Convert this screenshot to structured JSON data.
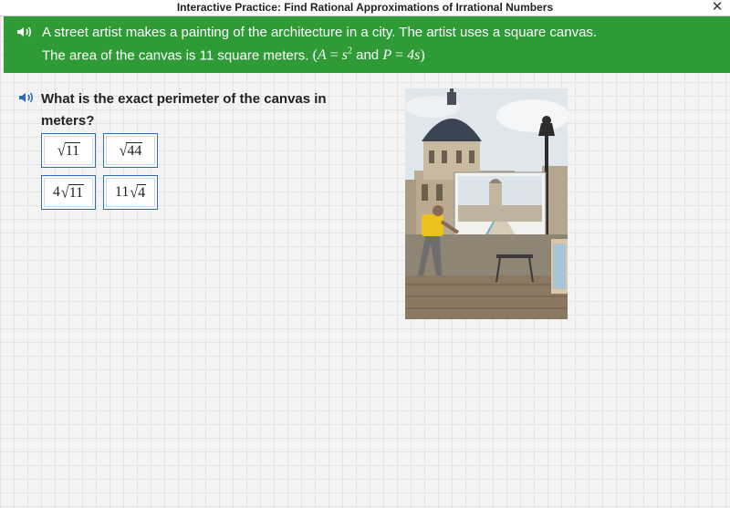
{
  "window": {
    "title": "Interactive Practice: Find Rational Approximations of Irrational Numbers",
    "close_glyph": "✕"
  },
  "banner": {
    "line1": "A street artist makes a painting of the architecture in a city. The artist uses a square canvas.",
    "line2_text": "The area of the canvas is 11 square meters.",
    "formula": {
      "open": "(",
      "a": "A",
      "eq1": " = ",
      "s": "s",
      "sup": "2",
      "and": " and ",
      "p": "P",
      "eq2": " = ",
      "rhs": "4s",
      "close": ")"
    }
  },
  "question": {
    "text": "What is the exact perimeter of the canvas in meters?",
    "choices": [
      {
        "coef": "",
        "radicand": "11"
      },
      {
        "coef": "",
        "radicand": "44"
      },
      {
        "coef": "4",
        "radicand": "11"
      },
      {
        "coef": "11",
        "radicand": "4"
      }
    ]
  },
  "colors": {
    "banner_green": "#2e9b36",
    "choice_border": "#2f6fb5",
    "speaker_blue": "#2f6fb5"
  },
  "icons": {
    "speaker": "speaker-icon",
    "close": "close-icon"
  }
}
